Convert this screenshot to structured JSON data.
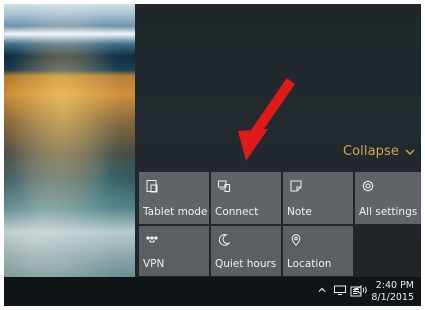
{
  "action_center": {
    "collapse_label": "Collapse",
    "tiles": [
      {
        "label": "Tablet mode",
        "icon": "tablet-mode-icon"
      },
      {
        "label": "Connect",
        "icon": "connect-icon"
      },
      {
        "label": "Note",
        "icon": "note-icon"
      },
      {
        "label": "All settings",
        "icon": "gear-icon"
      },
      {
        "label": "VPN",
        "icon": "vpn-icon"
      },
      {
        "label": "Quiet hours",
        "icon": "moon-icon"
      },
      {
        "label": "Location",
        "icon": "location-icon"
      }
    ]
  },
  "taskbar": {
    "time": "2:40 PM",
    "date": "8/1/2015",
    "tray_icons": [
      "chevron-up-icon",
      "network-icon",
      "volume-icon",
      "action-center-icon"
    ]
  },
  "colors": {
    "accent_collapse": "#d3a44a",
    "tile_bg": "#5f6468",
    "arrow": "#e0191a"
  }
}
